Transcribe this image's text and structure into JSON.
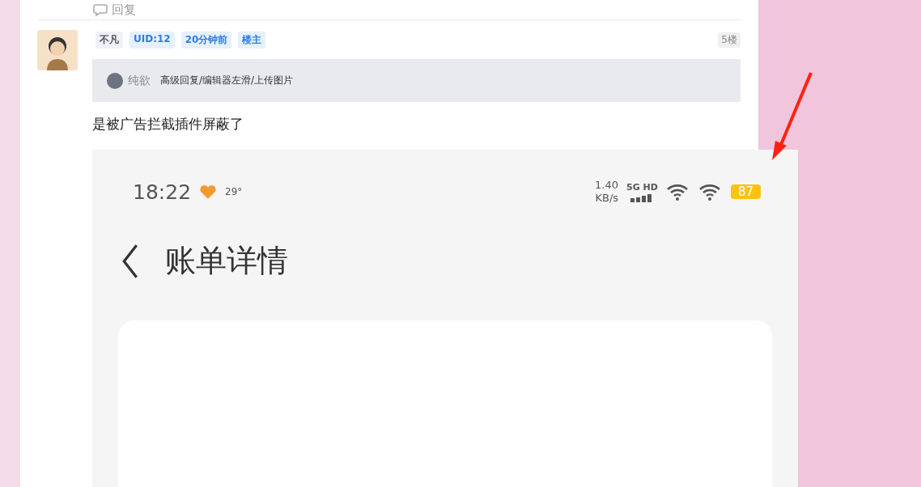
{
  "reply_link": {
    "label": "回复"
  },
  "post": {
    "tags": [
      {
        "kind": "name",
        "label": "不凡"
      },
      {
        "kind": "info",
        "label": "UID:12"
      },
      {
        "kind": "info",
        "label": "20分钟前"
      },
      {
        "kind": "info",
        "label": "楼主"
      }
    ],
    "floor": "5楼",
    "quote": {
      "user": "纯欲",
      "text": "高级回复/编辑器左滑/上传图片"
    },
    "content": "是被广告拦截插件屏蔽了",
    "screenshot": {
      "time": "18:22",
      "temperature": "29°",
      "speed_value": "1.40",
      "speed_unit": "KB/s",
      "network": "5G HD",
      "battery": "87",
      "title": "账单详情"
    }
  }
}
